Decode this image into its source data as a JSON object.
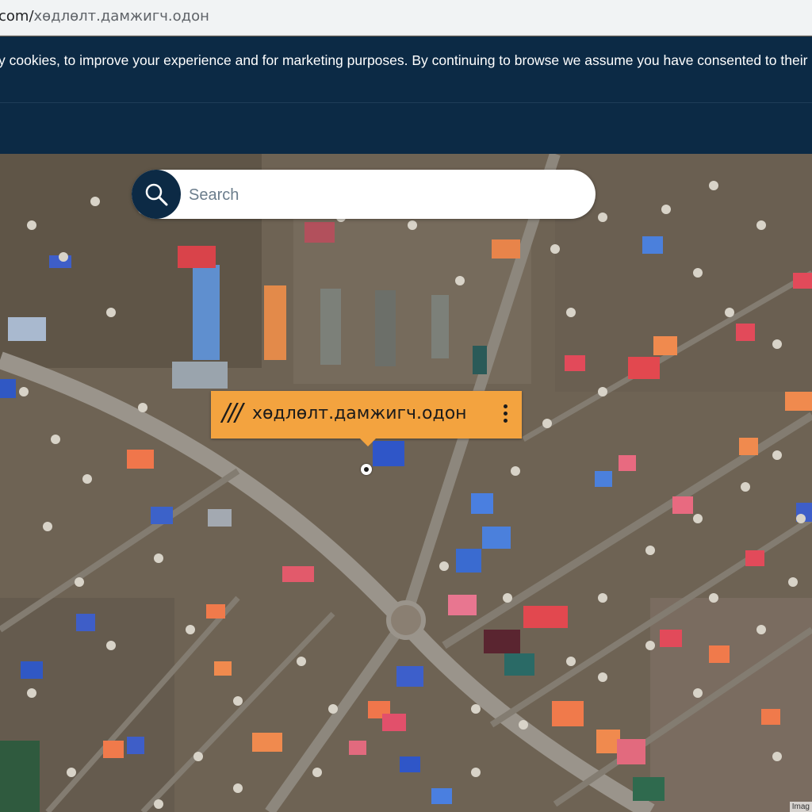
{
  "browser": {
    "url_host": "com/",
    "url_path": "хөдлөлт.дамжигч.одон"
  },
  "banner": {
    "cookie_text": "y cookies, to improve your experience and for marketing purposes. By continuing to browse we assume you have consented to their use"
  },
  "search": {
    "placeholder": "Search",
    "icon": "search-icon"
  },
  "location_tag": {
    "slashes": "///",
    "words": "хөдлөлт.дамжигч.одон",
    "menu_icon": "more-vertical-icon"
  },
  "map": {
    "attribution": "Imag"
  },
  "colors": {
    "banner_bg": "#0c2a45",
    "tag_bg": "#f3a33f"
  }
}
